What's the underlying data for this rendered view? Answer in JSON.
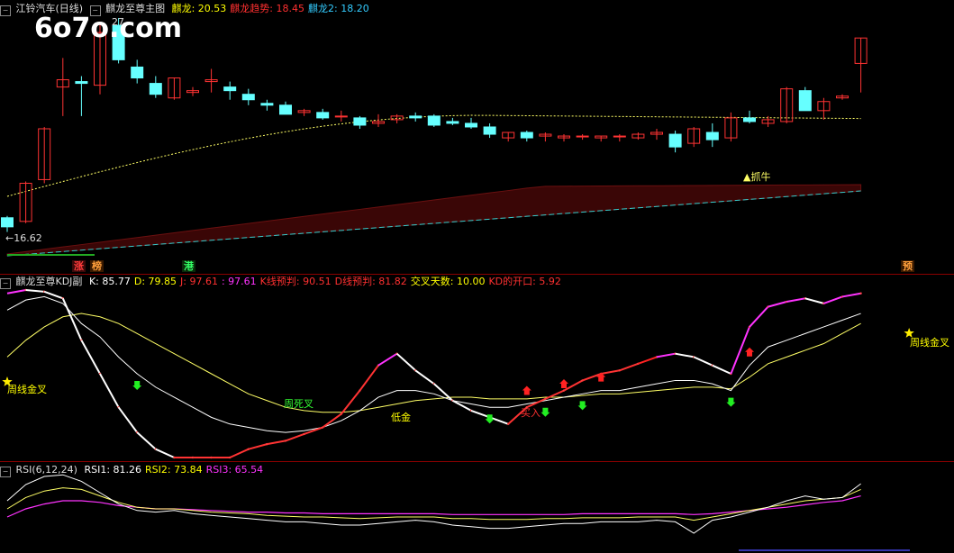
{
  "watermark": "6o7o.com",
  "main_panel": {
    "title": "江铃汽车(日线)",
    "indicator_name": "麒龙至尊主图",
    "legend": [
      {
        "label": "麒龙: 20.53",
        "color": "#ffff00"
      },
      {
        "label": "麒龙趋势: 18.45",
        "color": "#ff3030"
      },
      {
        "label": "麒龙2: 18.20",
        "color": "#33ccff"
      }
    ],
    "low_label": "←16.62",
    "high_label": "27",
    "signal_label": "▲抓牛",
    "bottom_tags": [
      {
        "text": "涨",
        "color": "#ff3b3b",
        "bg": "#3a0a0a"
      },
      {
        "text": "榜",
        "color": "#ff9f3b",
        "bg": "#3a1a00"
      },
      {
        "text": "港",
        "color": "#33ff66",
        "bg": "#0a2a0a"
      },
      {
        "text": "预",
        "color": "#ff9f3b",
        "bg": "#3a1a00"
      }
    ]
  },
  "kdj_panel": {
    "title": "麒龙至尊KDJ副",
    "legend": [
      {
        "label": "K: 85.77",
        "color": "#ffffff"
      },
      {
        "label": "D: 79.85",
        "color": "#ffff00"
      },
      {
        "label": "J: 97.61",
        "color": "#ff3030"
      },
      {
        "label": ": 97.61",
        "color": "#ff33ff"
      },
      {
        "label": "K线预判: 90.51",
        "color": "#ff3030"
      },
      {
        "label": "D线预判: 81.82",
        "color": "#ff3030"
      },
      {
        "label": "交叉天数: 10.00",
        "color": "#ffff00"
      },
      {
        "label": "KD的开口: 5.92",
        "color": "#ff3030"
      }
    ],
    "annotations": [
      {
        "text": "周线金叉",
        "color": "#ffff00"
      },
      {
        "text": "周死叉",
        "color": "#33ff33"
      },
      {
        "text": "低金",
        "color": "#ffff00"
      },
      {
        "text": "买入",
        "color": "#ff3030"
      },
      {
        "text": "周线金叉",
        "color": "#ffff00"
      }
    ]
  },
  "rsi_panel": {
    "title": "RSI(6,12,24)",
    "legend": [
      {
        "label": "RSI1: 81.26",
        "color": "#ffffff"
      },
      {
        "label": "RSI2: 73.84",
        "color": "#ffff00"
      },
      {
        "label": "RSI3: 65.54",
        "color": "#ff33ff"
      }
    ]
  },
  "chart_data": [
    {
      "type": "candlestick",
      "title": "江铃汽车(日线)",
      "ylim": [
        16.0,
        28.5
      ],
      "candles": [
        [
          17.4,
          17.5,
          16.62,
          16.9
        ],
        [
          17.2,
          19.4,
          17.1,
          19.3
        ],
        [
          19.5,
          22.4,
          19.3,
          22.3
        ],
        [
          24.6,
          26.2,
          23.0,
          25.0
        ],
        [
          24.9,
          25.2,
          23.0,
          24.8
        ],
        [
          24.7,
          28.2,
          24.2,
          27.6
        ],
        [
          28.0,
          28.4,
          25.9,
          26.1
        ],
        [
          25.7,
          26.1,
          24.8,
          25.1
        ],
        [
          24.8,
          25.2,
          24.0,
          24.2
        ],
        [
          24.0,
          25.1,
          23.9,
          25.1
        ],
        [
          24.3,
          24.6,
          24.1,
          24.4
        ],
        [
          24.9,
          25.6,
          24.3,
          25.0
        ],
        [
          24.6,
          24.9,
          23.9,
          24.4
        ],
        [
          24.2,
          24.5,
          23.6,
          23.9
        ],
        [
          23.7,
          23.9,
          23.3,
          23.6
        ],
        [
          23.6,
          23.8,
          23.1,
          23.1
        ],
        [
          23.2,
          23.4,
          23.0,
          23.3
        ],
        [
          23.2,
          23.4,
          22.8,
          22.9
        ],
        [
          23.0,
          23.3,
          22.7,
          23.0
        ],
        [
          22.9,
          23.0,
          22.3,
          22.5
        ],
        [
          22.6,
          23.1,
          22.4,
          22.7
        ],
        [
          22.8,
          23.1,
          22.6,
          23.0
        ],
        [
          23.0,
          23.2,
          22.7,
          22.9
        ],
        [
          23.0,
          23.1,
          22.4,
          22.5
        ],
        [
          22.7,
          22.9,
          22.5,
          22.6
        ],
        [
          22.6,
          22.9,
          22.3,
          22.4
        ],
        [
          22.4,
          22.6,
          21.8,
          22.0
        ],
        [
          21.8,
          22.1,
          21.6,
          22.1
        ],
        [
          22.1,
          22.2,
          21.6,
          21.8
        ],
        [
          21.9,
          22.1,
          21.6,
          22.0
        ],
        [
          21.8,
          22.0,
          21.6,
          21.9
        ],
        [
          21.9,
          22.0,
          21.7,
          21.9
        ],
        [
          21.8,
          21.9,
          21.6,
          21.9
        ],
        [
          21.9,
          22.0,
          21.6,
          21.9
        ],
        [
          21.8,
          22.1,
          21.7,
          22.0
        ],
        [
          22.0,
          22.3,
          21.7,
          22.1
        ],
        [
          22.0,
          22.2,
          21.0,
          21.3
        ],
        [
          21.5,
          22.4,
          21.3,
          22.3
        ],
        [
          22.1,
          22.6,
          21.3,
          21.7
        ],
        [
          21.8,
          23.2,
          21.6,
          22.9
        ],
        [
          22.9,
          23.3,
          22.6,
          22.7
        ],
        [
          22.6,
          23.0,
          22.4,
          22.8
        ],
        [
          22.7,
          24.6,
          22.6,
          24.5
        ],
        [
          24.4,
          24.6,
          23.3,
          23.3
        ],
        [
          23.3,
          24.0,
          22.8,
          23.8
        ],
        [
          24.0,
          24.2,
          23.9,
          24.1
        ],
        [
          25.9,
          27.3,
          24.3,
          27.3
        ]
      ]
    },
    {
      "type": "line",
      "title": "麒龙至尊KDJ副",
      "ylim": [
        0,
        100
      ],
      "series": [
        {
          "name": "K",
          "values": [
            88,
            94,
            96,
            92,
            80,
            72,
            60,
            50,
            42,
            36,
            30,
            24,
            20,
            18,
            16,
            15,
            16,
            18,
            22,
            28,
            36,
            40,
            40,
            38,
            34,
            32,
            30,
            30,
            32,
            34,
            36,
            38,
            40,
            40,
            42,
            44,
            46,
            46,
            44,
            40,
            55,
            66,
            70,
            74,
            78,
            82,
            86
          ]
        },
        {
          "name": "D",
          "values": [
            60,
            70,
            78,
            84,
            86,
            84,
            80,
            74,
            68,
            62,
            56,
            50,
            44,
            38,
            34,
            30,
            28,
            27,
            27,
            28,
            30,
            32,
            34,
            35,
            36,
            36,
            35,
            35,
            35,
            36,
            36,
            37,
            38,
            38,
            39,
            40,
            41,
            42,
            42,
            41,
            48,
            56,
            60,
            64,
            68,
            74,
            80
          ]
        },
        {
          "name": "J",
          "values": [
            98,
            100,
            99,
            95,
            70,
            50,
            30,
            15,
            5,
            0,
            0,
            0,
            0,
            5,
            8,
            10,
            14,
            18,
            26,
            40,
            55,
            62,
            52,
            44,
            34,
            28,
            24,
            20,
            30,
            35,
            40,
            46,
            50,
            52,
            56,
            60,
            62,
            60,
            55,
            50,
            78,
            90,
            93,
            95,
            92,
            96,
            98
          ]
        }
      ]
    },
    {
      "type": "line",
      "title": "RSI(6,12,24)",
      "ylim": [
        0,
        100
      ],
      "series": [
        {
          "name": "RSI1",
          "values": [
            60,
            80,
            90,
            92,
            84,
            70,
            56,
            48,
            46,
            48,
            44,
            42,
            40,
            38,
            36,
            34,
            34,
            32,
            30,
            30,
            32,
            34,
            36,
            34,
            30,
            28,
            26,
            26,
            28,
            30,
            32,
            32,
            34,
            34,
            34,
            36,
            34,
            20,
            36,
            40,
            46,
            52,
            60,
            66,
            62,
            64,
            81
          ]
        },
        {
          "name": "RSI2",
          "values": [
            50,
            64,
            72,
            76,
            74,
            66,
            58,
            52,
            50,
            50,
            48,
            46,
            45,
            44,
            42,
            41,
            40,
            40,
            39,
            38,
            39,
            40,
            40,
            40,
            38,
            38,
            37,
            37,
            37,
            38,
            38,
            39,
            39,
            39,
            40,
            40,
            40,
            36,
            40,
            44,
            48,
            52,
            56,
            60,
            62,
            64,
            74
          ]
        },
        {
          "name": "RSI3",
          "values": [
            40,
            50,
            56,
            60,
            60,
            58,
            54,
            52,
            50,
            50,
            49,
            48,
            47,
            46,
            46,
            45,
            45,
            44,
            44,
            44,
            44,
            44,
            44,
            44,
            43,
            43,
            43,
            43,
            43,
            43,
            43,
            44,
            44,
            44,
            44,
            44,
            44,
            43,
            44,
            46,
            48,
            50,
            52,
            55,
            58,
            60,
            66
          ]
        }
      ]
    }
  ]
}
